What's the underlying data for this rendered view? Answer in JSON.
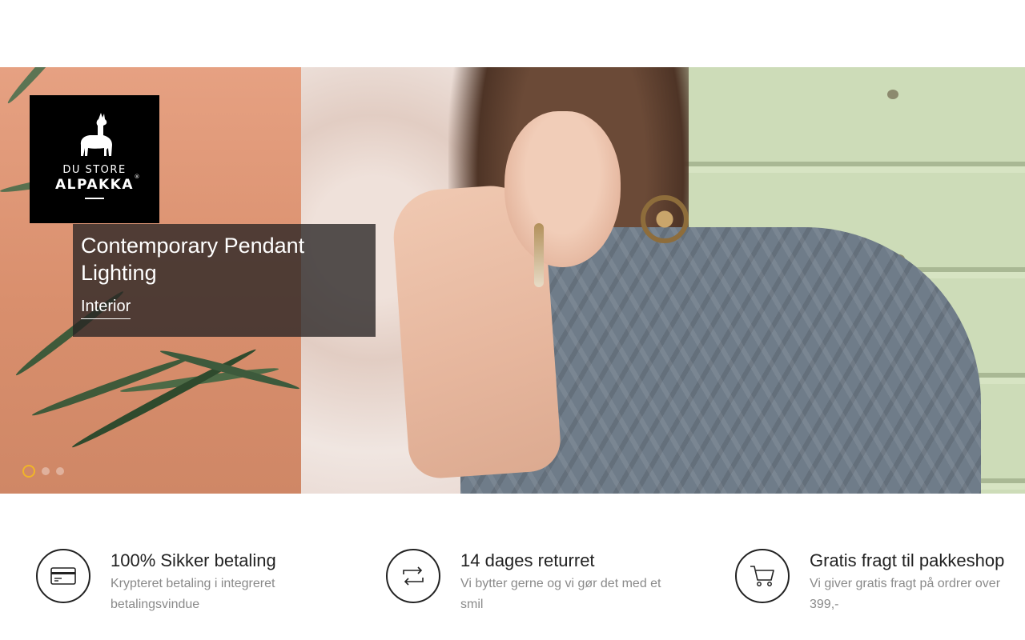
{
  "colors": {
    "caption_bg": "#282424",
    "dot_active": "#f0b429",
    "feature_title": "#222222",
    "feature_desc": "#8a8a8a"
  },
  "brand": {
    "logo_line1": "DU STORE",
    "logo_line2": "ALPAKKA",
    "logo_mark": "®",
    "logo_icon": "alpaca-icon"
  },
  "slider": {
    "caption_title": "Contemporary Pendant Lighting",
    "caption_link": "Interior",
    "slide_count": 3,
    "active_slide": 1
  },
  "features": [
    {
      "icon": "credit-card-icon",
      "title": "100% Sikker betaling",
      "desc": "Krypteret betaling i integreret betalingsvindue"
    },
    {
      "icon": "return-arrows-icon",
      "title": "14 dages returret",
      "desc": "Vi bytter gerne og vi gør det med et smil"
    },
    {
      "icon": "shopping-cart-icon",
      "title": "Gratis fragt til pakkeshop",
      "desc": "Vi giver gratis fragt på ordrer over 399,-"
    }
  ]
}
